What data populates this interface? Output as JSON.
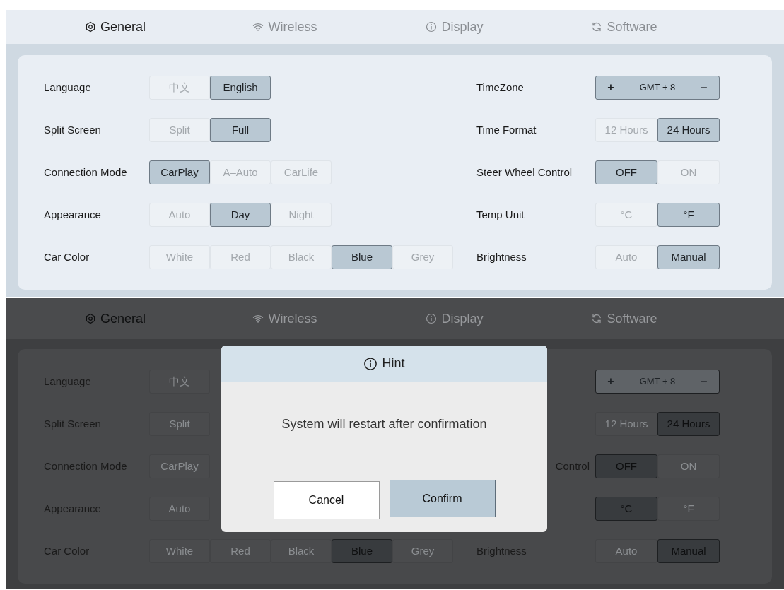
{
  "screens": [
    {
      "tabs": [
        {
          "label": "General",
          "selected": true
        },
        {
          "label": "Wireless",
          "selected": false
        },
        {
          "label": "Display",
          "selected": false
        },
        {
          "label": "Software",
          "selected": false
        }
      ],
      "left_rows": [
        {
          "label": "Language",
          "options": [
            {
              "text": "中文",
              "selected": false
            },
            {
              "text": "English",
              "selected": true
            }
          ]
        },
        {
          "label": "Split Screen",
          "options": [
            {
              "text": "Split",
              "selected": false
            },
            {
              "text": "Full",
              "selected": true
            }
          ]
        },
        {
          "label": "Connection Mode",
          "options": [
            {
              "text": "CarPlay",
              "selected": true
            },
            {
              "text": "A–Auto",
              "selected": false
            },
            {
              "text": "CarLife",
              "selected": false
            }
          ]
        },
        {
          "label": "Appearance",
          "options": [
            {
              "text": "Auto",
              "selected": false
            },
            {
              "text": "Day",
              "selected": true
            },
            {
              "text": "Night",
              "selected": false
            }
          ]
        },
        {
          "label": "Car Color",
          "options": [
            {
              "text": "White",
              "selected": false
            },
            {
              "text": "Red",
              "selected": false
            },
            {
              "text": "Black",
              "selected": false
            },
            {
              "text": "Blue",
              "selected": true
            },
            {
              "text": "Grey",
              "selected": false
            }
          ]
        }
      ],
      "right_rows": [
        {
          "label": "TimeZone",
          "kind": "stepper",
          "plus": "+",
          "value": "GMT + 8",
          "minus": "–"
        },
        {
          "label": "Time Format",
          "kind": "segments",
          "options": [
            {
              "text": "12 Hours",
              "selected": false
            },
            {
              "text": "24 Hours",
              "selected": true
            }
          ]
        },
        {
          "label": "Steer Wheel Control",
          "kind": "segments",
          "options": [
            {
              "text": "OFF",
              "selected": true
            },
            {
              "text": "ON",
              "selected": false
            }
          ]
        },
        {
          "label": "Temp Unit",
          "kind": "segments",
          "options": [
            {
              "text": "°C",
              "selected": false
            },
            {
              "text": "°F",
              "selected": true
            }
          ]
        },
        {
          "label": "Brightness",
          "kind": "segments",
          "options": [
            {
              "text": "Auto",
              "selected": false
            },
            {
              "text": "Manual",
              "selected": true
            }
          ]
        }
      ]
    },
    {
      "tabs": [
        {
          "label": "General",
          "selected": true
        },
        {
          "label": "Wireless",
          "selected": false
        },
        {
          "label": "Display",
          "selected": false
        },
        {
          "label": "Software",
          "selected": false
        }
      ],
      "left_rows": [
        {
          "label": "Language",
          "options": [
            {
              "text": "中文",
              "selected": false
            }
          ]
        },
        {
          "label": "Split Screen",
          "options": [
            {
              "text": "Split",
              "selected": false
            }
          ]
        },
        {
          "label": "Connection Mode",
          "options": [
            {
              "text": "CarPlay",
              "selected": false
            }
          ]
        },
        {
          "label": "Appearance",
          "options": [
            {
              "text": "Auto",
              "selected": false
            }
          ]
        },
        {
          "label": "Car Color",
          "options": [
            {
              "text": "White",
              "selected": false
            },
            {
              "text": "Red",
              "selected": false
            },
            {
              "text": "Black",
              "selected": false
            },
            {
              "text": "Blue",
              "selected": true
            },
            {
              "text": "Grey",
              "selected": false
            }
          ]
        }
      ],
      "right_rows": [
        {
          "kind": "stepper",
          "plus": "+",
          "value": "GMT + 8",
          "minus": "–"
        },
        {
          "kind": "segments",
          "options": [
            {
              "text": "12 Hours",
              "selected": false
            },
            {
              "text": "24 Hours",
              "selected": true
            }
          ]
        },
        {
          "label": "Control",
          "label_clipped": true,
          "kind": "segments",
          "options": [
            {
              "text": "OFF",
              "selected": true
            },
            {
              "text": "ON",
              "selected": false
            }
          ]
        },
        {
          "kind": "segments",
          "options": [
            {
              "text": "°C",
              "selected": true
            },
            {
              "text": "°F",
              "selected": false
            }
          ]
        },
        {
          "label": "Brightness",
          "kind": "segments",
          "options": [
            {
              "text": "Auto",
              "selected": false
            },
            {
              "text": "Manual",
              "selected": true
            }
          ]
        }
      ],
      "dialog": {
        "title": "Hint",
        "message": "System will restart after confirmation",
        "cancel": "Cancel",
        "confirm": "Confirm"
      }
    }
  ]
}
